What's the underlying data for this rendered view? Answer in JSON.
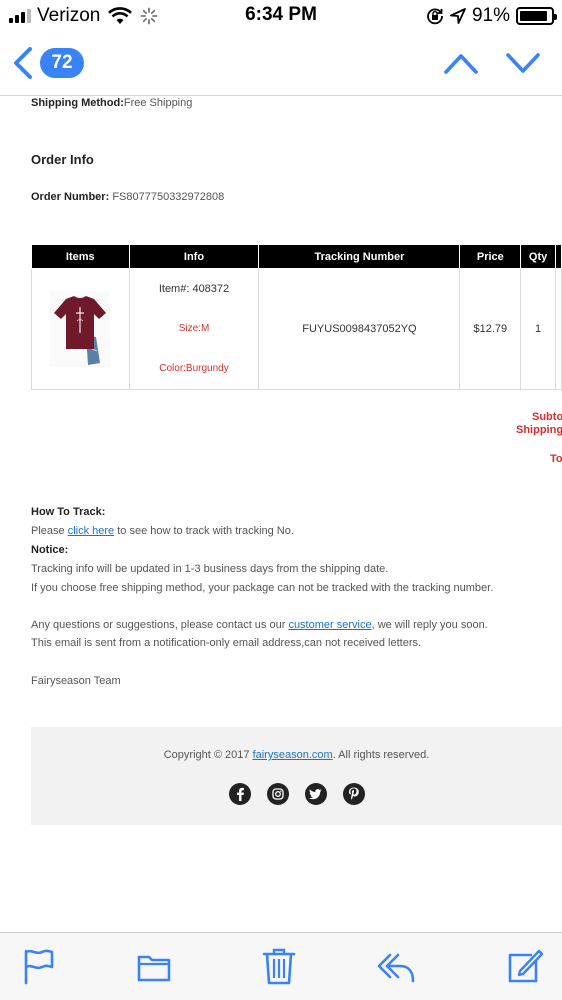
{
  "status_bar": {
    "carrier": "Verizon",
    "time": "6:34 PM",
    "battery_percent": "91%",
    "battery_level": 0.91,
    "icons": [
      "signal-bars-icon",
      "wifi-icon",
      "activity-spinner-icon",
      "orientation-lock-icon",
      "location-arrow-icon",
      "battery-icon"
    ]
  },
  "nav": {
    "unread_count": "72",
    "icons": [
      "back-chevron-icon",
      "previous-message-icon",
      "next-message-icon"
    ]
  },
  "email": {
    "shipping_method_label": "Shipping Method:",
    "shipping_method_value": "Free Shipping",
    "order_info_heading": "Order Info",
    "order_number_label": "Order Number:",
    "order_number_value": "FS8077750332972808",
    "table": {
      "headers": [
        "Items",
        "Info",
        "Tracking Number",
        "Price",
        "Qty"
      ],
      "rows": [
        {
          "image": "burgundy-tshirt-image",
          "item_no": "Item#: 408372",
          "size": "Size:M",
          "color": "Color:Burgundy",
          "tracking_number": "FUYUS0098437052YQ",
          "price": "$12.79",
          "qty": "1"
        }
      ]
    },
    "summary": {
      "subtotal_label": "Subto",
      "shipping_label": "Shipping",
      "total_label": "To"
    },
    "how_to_track_heading": "How To Track:",
    "track_please": "Please ",
    "track_link": "click here",
    "track_rest": " to see how to track with tracking No.",
    "notice_heading": "Notice:",
    "notice_line1": "Tracking info will be updated in 1-3 business days from the shipping date.",
    "notice_line2": "If you choose free shipping method, your package can not be tracked with the tracking number.",
    "contact_pre": "Any questions or suggestions, please contact us our ",
    "contact_link": "customer service",
    "contact_post": ", we will reply you soon.",
    "notification_line": "This email is sent from a notification-only email address,can not received letters.",
    "signature": "Fairyseason Team",
    "footer": {
      "copyright_pre": "Copyright © 2017 ",
      "copyright_link": "fairyseason.com",
      "copyright_post": ". All rights reserved.",
      "social_icons": [
        "facebook-icon",
        "instagram-icon",
        "twitter-icon",
        "pinterest-icon"
      ]
    }
  },
  "toolbar": {
    "icons": [
      "flag-icon",
      "folder-icon",
      "trash-icon",
      "reply-icon",
      "compose-icon"
    ]
  },
  "colors": {
    "accent_blue": "#3a82f7",
    "link_blue": "#1a73c8",
    "attribute_red": "#d0312d",
    "table_header_black": "#000000",
    "footer_gray": "#f2f2f2"
  }
}
